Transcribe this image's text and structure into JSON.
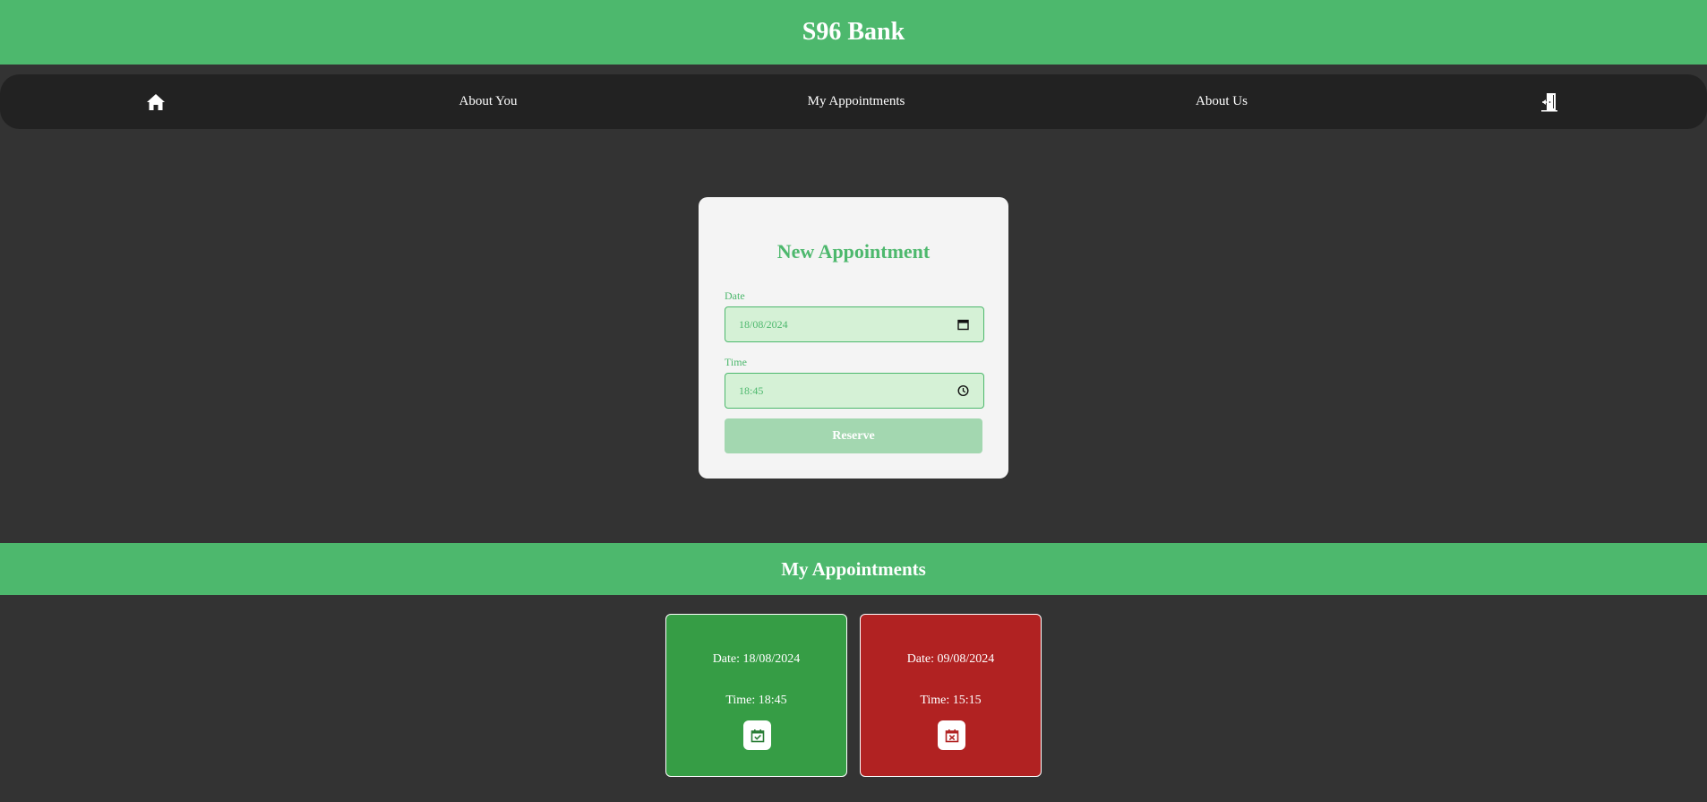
{
  "app": {
    "title": "S96 Bank"
  },
  "nav": {
    "home_icon": "home-icon",
    "about_you": "About You",
    "my_appointments": "My Appointments",
    "about_us": "About Us",
    "logout_icon": "logout-door-icon"
  },
  "form": {
    "title": "New Appointment",
    "date_label": "Date",
    "date_value": "18/08/2024",
    "time_label": "Time",
    "time_value": "18:45",
    "reserve_label": "Reserve"
  },
  "appointments": {
    "title": "My Appointments",
    "items": [
      {
        "date": "Date: 18/08/2024",
        "time": "Time: 18:45",
        "status": "confirmed",
        "color": "#369d45",
        "icon": "calendar-check-icon"
      },
      {
        "date": "Date: 09/08/2024",
        "time": "Time: 15:15",
        "status": "cancelled",
        "color": "#b12222",
        "icon": "calendar-x-icon"
      }
    ]
  },
  "colors": {
    "brand_green": "#4db86d",
    "nav_bg": "#222222",
    "page_bg": "#333333",
    "field_bg": "#d5f1d6",
    "reserve_bg": "#a3d7b0"
  }
}
